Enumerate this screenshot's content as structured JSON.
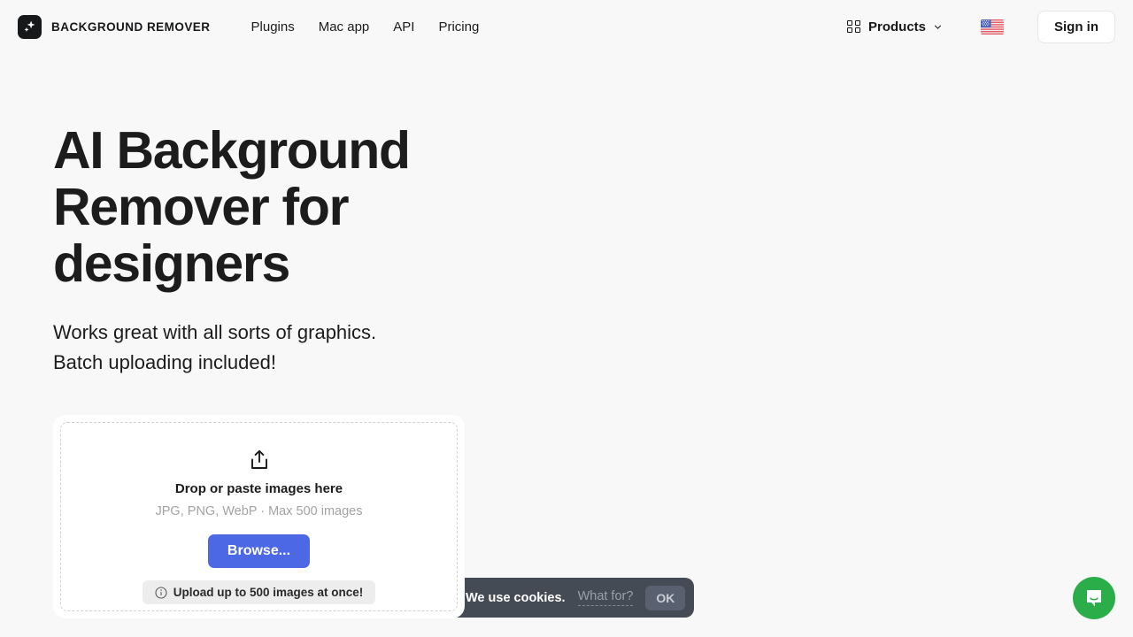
{
  "header": {
    "brand_name": "BACKGROUND REMOVER",
    "brand_icon": "sparkle-logo-icon",
    "nav": [
      {
        "label": "Plugins"
      },
      {
        "label": "Mac app"
      },
      {
        "label": "API"
      },
      {
        "label": "Pricing"
      }
    ],
    "products_label": "Products",
    "products_icon": "grid-icon",
    "products_chevron": "chevron-down-icon",
    "language_flag": "us-flag-icon",
    "signin_label": "Sign in"
  },
  "hero": {
    "headline": "AI Background Remover for designers",
    "subhead_line1": "Works great with all sorts of graphics.",
    "subhead_line2": "Batch uploading included!"
  },
  "dropzone": {
    "icon": "upload-icon",
    "title": "Drop or paste images here",
    "formats": "JPG, PNG, WebP · Max 500 images",
    "browse_label": "Browse...",
    "hint_icon": "info-circle-icon",
    "hint_label": "Upload up to 500 images at once!"
  },
  "cookie_banner": {
    "message": "We use cookies.",
    "link_label": "What for?",
    "ok_label": "OK"
  },
  "chat": {
    "icon": "chat-bubble-icon"
  },
  "colors": {
    "page_bg": "#f8f8f8",
    "text": "#1c1c1c",
    "accent_blue": "#4c68e4",
    "cookie_bg": "#454b55",
    "chat_green": "#2bae4a",
    "muted": "#a3a3a3"
  }
}
